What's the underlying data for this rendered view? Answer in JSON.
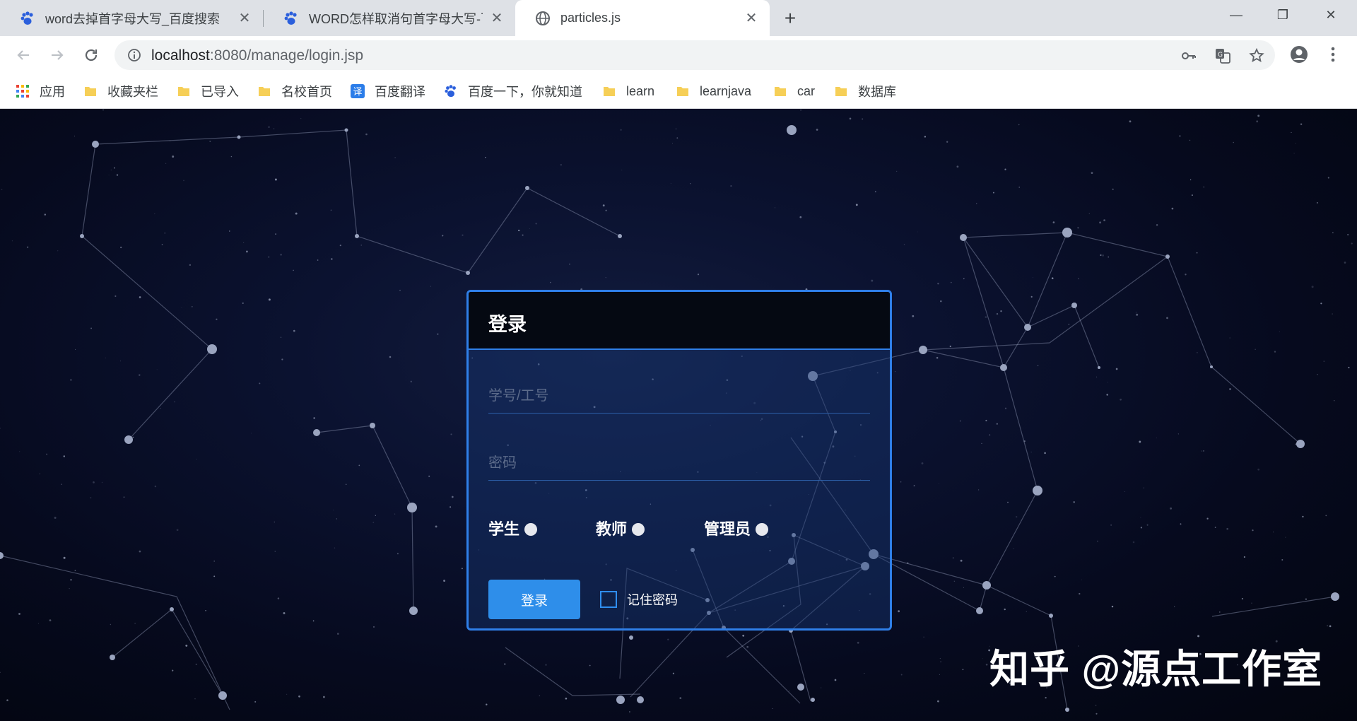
{
  "browser": {
    "tabs": [
      {
        "title": "word去掉首字母大写_百度搜索",
        "icon": "baidu-paw-icon"
      },
      {
        "title": "WORD怎样取消句首字母大写-百",
        "icon": "baidu-paw-icon"
      },
      {
        "title": "particles.js",
        "icon": "globe-icon"
      }
    ],
    "active_tab": 2,
    "window_controls": {
      "minimize": "—",
      "restore": "❐",
      "close": "✕"
    },
    "url": {
      "host": "localhost",
      "rest": ":8080/manage/login.jsp"
    },
    "bookmarks": [
      {
        "label": "应用",
        "icon": "apps-grid-icon"
      },
      {
        "label": "收藏夹栏",
        "icon": "folder-icon"
      },
      {
        "label": "已导入",
        "icon": "folder-icon"
      },
      {
        "label": "名校首页",
        "icon": "folder-icon"
      },
      {
        "label": "百度翻译",
        "icon": "baidu-translate-icon"
      },
      {
        "label": "百度一下，你就知道",
        "icon": "baidu-paw-icon"
      },
      {
        "label": "learn",
        "icon": "folder-icon"
      },
      {
        "label": "learnjava",
        "icon": "folder-icon"
      },
      {
        "label": "car",
        "icon": "folder-icon"
      },
      {
        "label": "数据库",
        "icon": "folder-icon"
      }
    ]
  },
  "login": {
    "title": "登录",
    "username_placeholder": "学号/工号",
    "password_placeholder": "密码",
    "roles": [
      "学生",
      "教师",
      "管理员"
    ],
    "submit_label": "登录",
    "remember_label": "记住密码"
  },
  "watermark": "知乎 @源点工作室",
  "colors": {
    "accent": "#2f7fe8",
    "button": "#2e8eea",
    "background": "#05091a"
  }
}
